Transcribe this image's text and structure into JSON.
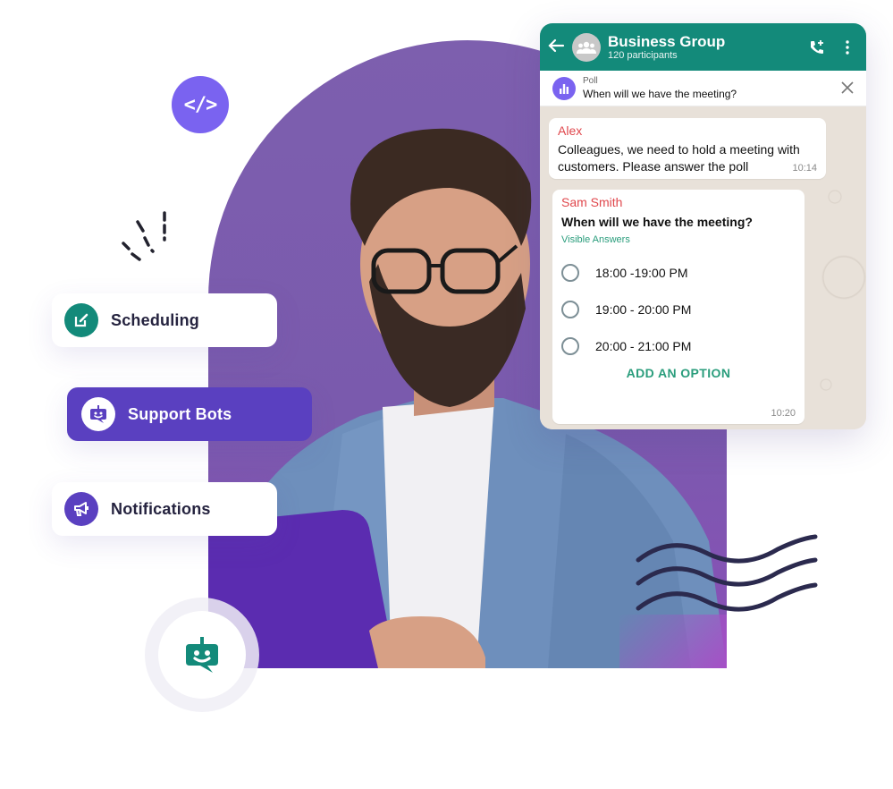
{
  "features": {
    "code_badge": "</>",
    "scheduling": {
      "label": "Scheduling",
      "icon": "edit-icon"
    },
    "support_bots": {
      "label": "Support Bots",
      "icon": "bot-icon"
    },
    "notifications": {
      "label": "Notifications",
      "icon": "megaphone-icon"
    }
  },
  "chat": {
    "header": {
      "group_name": "Business Group",
      "participants": "120 participants",
      "back_icon": "arrow-left-icon",
      "call_icon": "add-call-icon",
      "menu_icon": "more-vertical-icon"
    },
    "pinned": {
      "label": "Poll",
      "question": "When will we have the meeting?",
      "close_icon": "close-icon"
    },
    "messages": [
      {
        "sender": "Alex",
        "text": "Colleagues, we need to hold a meeting with customers. Please answer the poll",
        "time": "10:14"
      },
      {
        "sender": "Sam Smith",
        "poll_question": "When will we have the meeting?",
        "visibility": "Visible Answers",
        "options": [
          "18:00 -19:00 PM",
          "19:00 - 20:00 PM",
          "20:00 - 21:00 PM"
        ],
        "add_option": "ADD AN OPTION",
        "time": "10:20"
      }
    ]
  },
  "colors": {
    "brand_purple": "#5a40c0",
    "accent_violet": "#7a63f0",
    "whatsapp_green": "#138a7a",
    "sender_red": "#e0474c",
    "link_green": "#2a9d7c"
  }
}
